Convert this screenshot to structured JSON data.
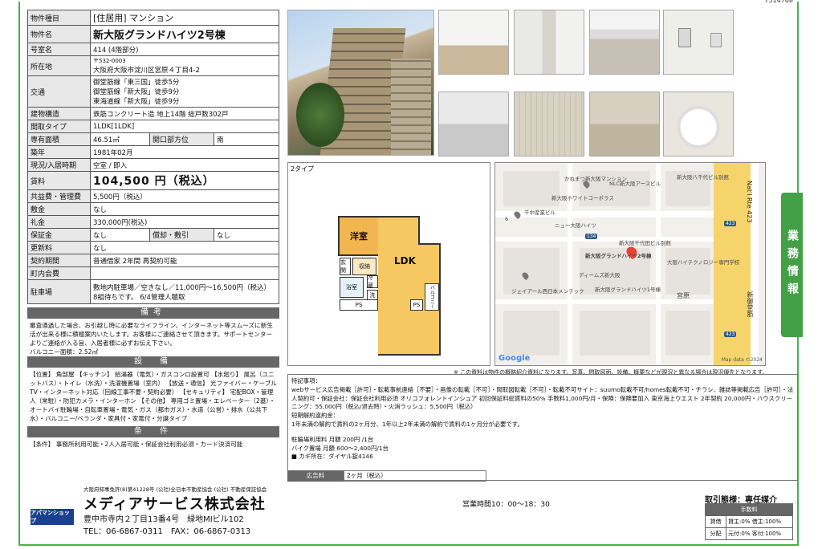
{
  "top_code": "7514768",
  "spec": {
    "type_label": "物件種目",
    "type_value": "[住居用] マンション",
    "name_label": "物件名",
    "name_value": "新大阪グランドハイツ2号棟",
    "room_label": "号室名",
    "room_value": "414 (4階部分)",
    "address_label": "所在地",
    "postal": "〒532-0003",
    "address": "大阪府大阪市淀川区宮原４丁目4-2",
    "transit_label": "交通",
    "transit": [
      "御堂筋線「東三国」徒歩5分",
      "御堂筋線「新大阪」徒歩9分",
      "東海道線「新大阪」徒歩9分"
    ],
    "structure_label": "建物構造",
    "structure_value": "鉄筋コンクリート造 地上14階 総戸数302戸",
    "layout_label": "間取タイプ",
    "layout_value": "1LDK[1LDK]",
    "area_label": "専有面積",
    "area_value": "46.51㎡",
    "opening_label": "開口部方位",
    "opening_value": "南",
    "built_label": "築年",
    "built_value": "1981年02月",
    "status_label": "現況/入居時期",
    "status_value": "空室 / 即入",
    "rent_label": "賃料",
    "rent_value": "104,500 円（税込）",
    "common_label": "共益費・管理費",
    "common_value": "5,500円（税込）",
    "deposit_label": "敷金",
    "deposit_value": "なし",
    "key_label": "礼金",
    "key_value": "330,000円(税込)",
    "security_label": "保証金",
    "security_value": "なし",
    "amort_label": "償却・敷引",
    "amort_value": "なし",
    "renewal_label": "更新料",
    "renewal_value": "なし",
    "contract_label": "契約期間",
    "contract_value": "普通借家 2年間 再契約可能",
    "town_label": "町内会費",
    "town_value": "",
    "parking_label": "駐車場",
    "parking_value1": "敷地内駐車場／空きなし／11,000円〜16,500円（税込）",
    "parking_value2": "8組待ちです。 6/4管理人聴取"
  },
  "remarks": {
    "head": "備考",
    "text": "審査通過した場合、お引越し時に必要なライフライン、インターネット等スムーズに新生活が出来る様に積極案内いたします。お客様にご連絡させて頂きます。サポートセンターよりご連絡が入る旨、入居者様に必ずお伝え下さい。",
    "balcony": "バルコニー面積：2.52㎡"
  },
  "equipment": {
    "head": "設　備",
    "text": "【位置】 角部屋 【キッチン】 給湯器（電気）・ガスコンロ設置可 【水廻り】 風呂（ユニットバス）・トイレ（水洗）・洗濯機置場（室内） 【放送・通信】 光ファイバー・ケーブルTV・インターネット対応（回線工事不要・契約必要） 【セキュリティ】 宅配BOX・管理人（常駐）・防犯カメラ・インターホン 【その他】 専用ゴミ置場・エレベーター（2基）・オートバイ駐輪場・自転車置場・電気・ガス（都市ガス）・水道（公営）・排水（公共下水）・バルコニー/ベランダ・家具付・家電付・分譲タイプ"
  },
  "conditions": {
    "head": "条　件",
    "text": "【条件】 事務所利用可能・2人入居可能・保証会社利用必須・カード決済可能"
  },
  "plan": {
    "label": "2タイプ",
    "room1": "洋室",
    "room2": "LDK",
    "genkan": "玄関",
    "fr": "冷蔵",
    "wm": "洗",
    "bath": "浴室",
    "balc": "バルコニー",
    "ps1": "PS",
    "ps2": "PS",
    "sr": "収納"
  },
  "map": {
    "labels": [
      "かねまつ新大阪マンション",
      "NLC新大阪アースビル",
      "新大阪八千代ビル別館",
      "新大阪ホワイトコーポラス",
      "千中産業ビル",
      "ニュー大阪ハイツ",
      "新大阪千代田ビル別館",
      "新大阪グランドハイツ2号棟",
      "大阪ハイテクノロジー専門学校",
      "ディームズ新大阪",
      "新大阪グランドハイツ1号棟",
      "ジェイアール西日本メンテック",
      "宮原"
    ],
    "route_shield1": "134",
    "route_shield2": "423",
    "route_shield3": "423",
    "route_num": "6",
    "vertical1": "Nat'l Rte 423",
    "vertical2": "新御堂筋",
    "google": "Google",
    "mapdata": "Map data ©2024"
  },
  "side_tab": "業務情報",
  "notice": "※ この資料は物件の概略紹介資料になります。写真、間取図面、設備、概要などが現況と異なる場合は現況優先となります。",
  "special": {
    "head": "特記事項：",
    "lines": [
      "webサービス広告掲載［許可］・転載事前連絡［不要］・画像の転載［不可］・間取図転載［不可］・転載不可サイト：suumo転載不可/homes転載不可・チラシ、雑誌等掲載広告［許可］・法人契約可・保証会社：保証会社利用必須 オリコフォレントインシュア 初回保証料総賃料の50% 手数料1,000円/月・保険：保険要加入 東京海上ウエスト 2年契約 20,000円・ハウスクリーニング：55,000円（税込/退去時）・火消ラッシュ：5,500円（税込）",
      "短期解約違約金：",
      "1年未満の解約で賃料の2ヶ月分、1年以上2年未満の解約で賃料の1ヶ月分が必要です。",
      "",
      "駐輪場利用料 月額 200円 /1台",
      "バイク置場 月額 600〜2,400円/1台",
      "■ カギ所在：ダイヤル錠4146"
    ]
  },
  "adfee": {
    "label": "広告料",
    "value": "2ヶ月（税込）"
  },
  "footer": {
    "license": "大阪府知事免許(8)第41228号 (公社)全日本不動産協会 (公社) 不動産保証協会",
    "logo": "アパマンショップ",
    "company": "メディアサービス株式会社",
    "address": "豊中市寺内２丁目13番4号　緑地MIビル102",
    "tel": "TEL：06-6867-0311　FAX：06-6867-0313",
    "hours": "営業時間10：00〜18：30",
    "deal": "取引態様：専任媒介",
    "fee_head": "手数料",
    "fee_rows": [
      {
        "k": "貸借",
        "v": "貸主:0% 借主:100%"
      },
      {
        "k": "分配",
        "v": "元付:0% 客付:100%"
      }
    ]
  }
}
